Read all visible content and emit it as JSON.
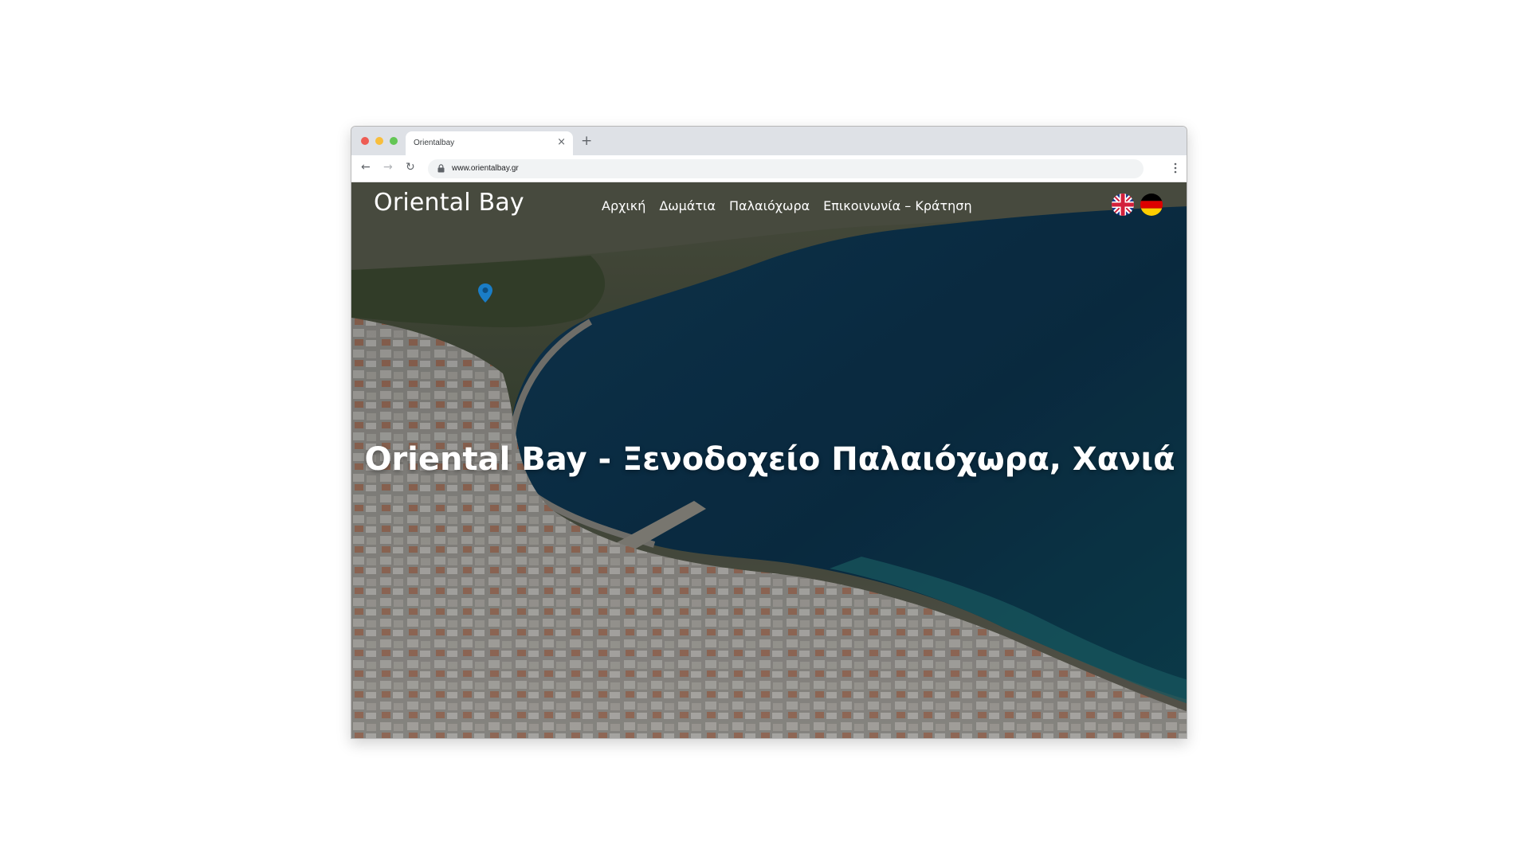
{
  "browser": {
    "tab_title": "Orientalbay",
    "tab_close": "×",
    "new_tab": "+",
    "url": "www.orientalbay.gr",
    "nav": {
      "back": "←",
      "forward": "→",
      "reload": "↻"
    }
  },
  "site": {
    "logo": "Oriental Bay",
    "nav_items": [
      {
        "label": "Αρχική"
      },
      {
        "label": "Δωμάτια"
      },
      {
        "label": "Παλαιόχωρα"
      },
      {
        "label": "Επικοινωνία – Κράτηση"
      }
    ],
    "languages": [
      {
        "name": "uk-flag-icon"
      },
      {
        "name": "germany-flag-icon"
      }
    ],
    "hero_title": "Oriental Bay - Ξενοδοχείο Παλαιόχωρα, Χανιά"
  },
  "colors": {
    "sea": "#0f3d5a",
    "land": "#4f5a45",
    "overlay": "rgba(0,0,0,0.28)"
  }
}
